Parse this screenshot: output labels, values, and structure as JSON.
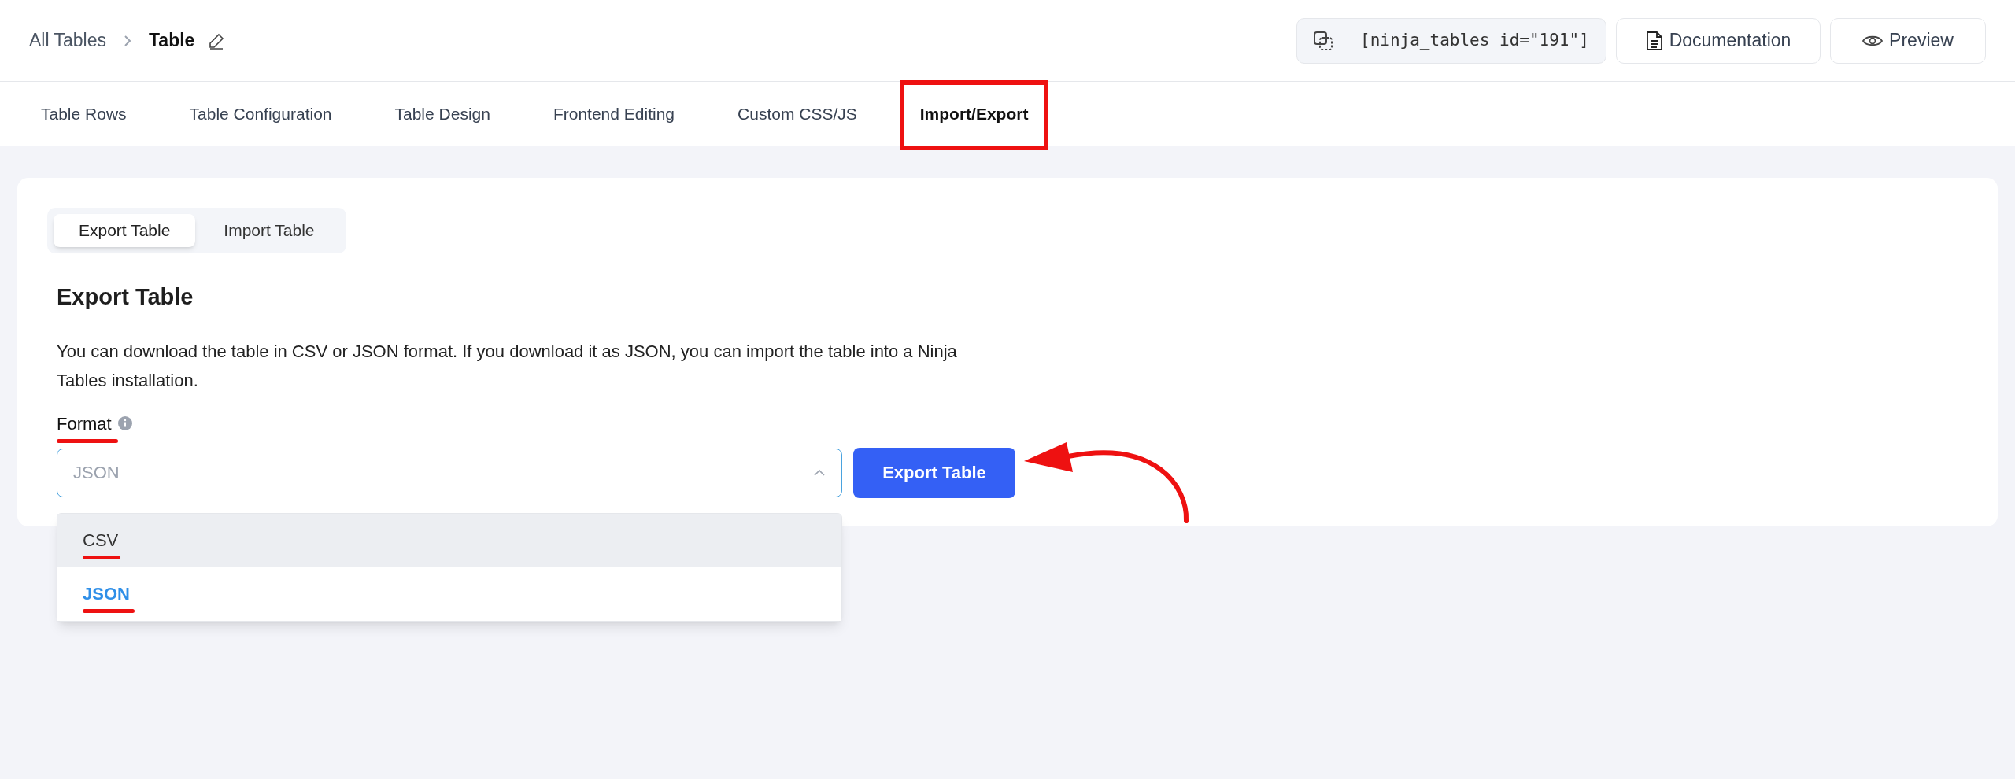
{
  "breadcrumb": {
    "parent": "All Tables",
    "current": "Table"
  },
  "shortcode": "[ninja_tables id=\"191\"]",
  "header_buttons": [
    {
      "kind": "doc",
      "label": "Documentation"
    },
    {
      "kind": "preview",
      "label": "Preview"
    }
  ],
  "tabs": [
    {
      "label": "Table Rows",
      "selected": false,
      "highlighted": false
    },
    {
      "label": "Table Configuration",
      "selected": false,
      "highlighted": false
    },
    {
      "label": "Table Design",
      "selected": false,
      "highlighted": false
    },
    {
      "label": "Frontend Editing",
      "selected": false,
      "highlighted": false
    },
    {
      "label": "Custom CSS/JS",
      "selected": false,
      "highlighted": false
    },
    {
      "label": "Import/Export",
      "selected": true,
      "highlighted": true
    }
  ],
  "sub_tabs": [
    {
      "label": "Export Table",
      "selected": true
    },
    {
      "label": "Import Table",
      "selected": false
    }
  ],
  "section": {
    "title": "Export Table",
    "description": "You can download the table in CSV or JSON format. If you download it as JSON, you can import the table into a Ninja Tables installation."
  },
  "format_field": {
    "label": "Format",
    "underlined": true,
    "value": "JSON",
    "expanded": true,
    "options": [
      {
        "label": "CSV",
        "selected": false,
        "hovered": true,
        "underlined": true
      },
      {
        "label": "JSON",
        "selected": true,
        "hovered": false,
        "underlined": true
      }
    ]
  },
  "export_button": "Export Table",
  "pointer_arrow": true
}
